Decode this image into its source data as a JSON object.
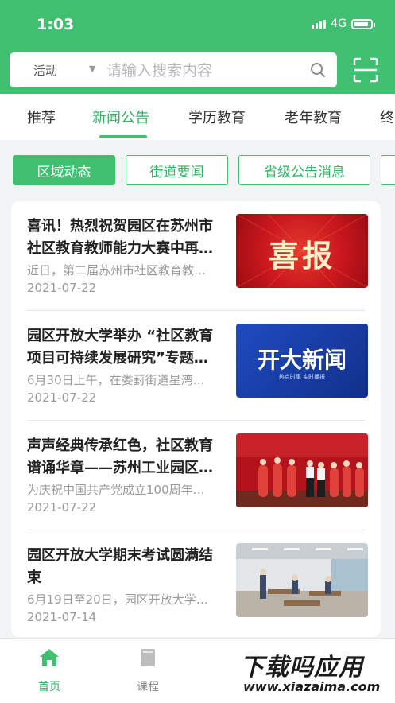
{
  "status": {
    "time": "1:03",
    "network": "4G"
  },
  "search": {
    "category": "活动",
    "placeholder": "请输入搜索内容"
  },
  "tabs": [
    {
      "label": "推荐"
    },
    {
      "label": "新闻公告",
      "active": true
    },
    {
      "label": "学历教育"
    },
    {
      "label": "老年教育"
    },
    {
      "label": "终"
    }
  ],
  "chips": [
    {
      "label": "区域动态",
      "active": true
    },
    {
      "label": "街道要闻"
    },
    {
      "label": "省级公告消息"
    }
  ],
  "news": [
    {
      "title": "喜讯！热烈祝贺园区在苏州市社区教育教师能力大赛中再…",
      "summary": "近日，第二届苏州市社区教育教…",
      "date": "2021-07-22",
      "thumb_text": "喜报"
    },
    {
      "title": "园区开放大学举办 “社区教育项目可持续发展研究”专题…",
      "summary": "6月30日上午，在娄葑街道星湾…",
      "date": "2021-07-22",
      "thumb_text": "开大新闻",
      "thumb_subtext": "热点时事 实时播报"
    },
    {
      "title": "声声经典传承红色，社区教育谱诵华章——苏州工业园区…",
      "summary": "为庆祝中国共产党成立100周年…",
      "date": "2021-07-22"
    },
    {
      "title": "园区开放大学期末考试圆满结束",
      "summary": "6月19日至20日，园区开放大学…",
      "date": "2021-07-14"
    }
  ],
  "tabbar": [
    {
      "label": "首页",
      "icon": "home-icon",
      "active": true
    },
    {
      "label": "课程",
      "icon": "book-icon"
    }
  ],
  "watermark": {
    "main": "下载吗应用",
    "sub": "www.xiazaima.com"
  },
  "colors": {
    "brand": "#3fbf6f",
    "news_red": "#c8161d",
    "news_blue": "#1a3fa8"
  }
}
